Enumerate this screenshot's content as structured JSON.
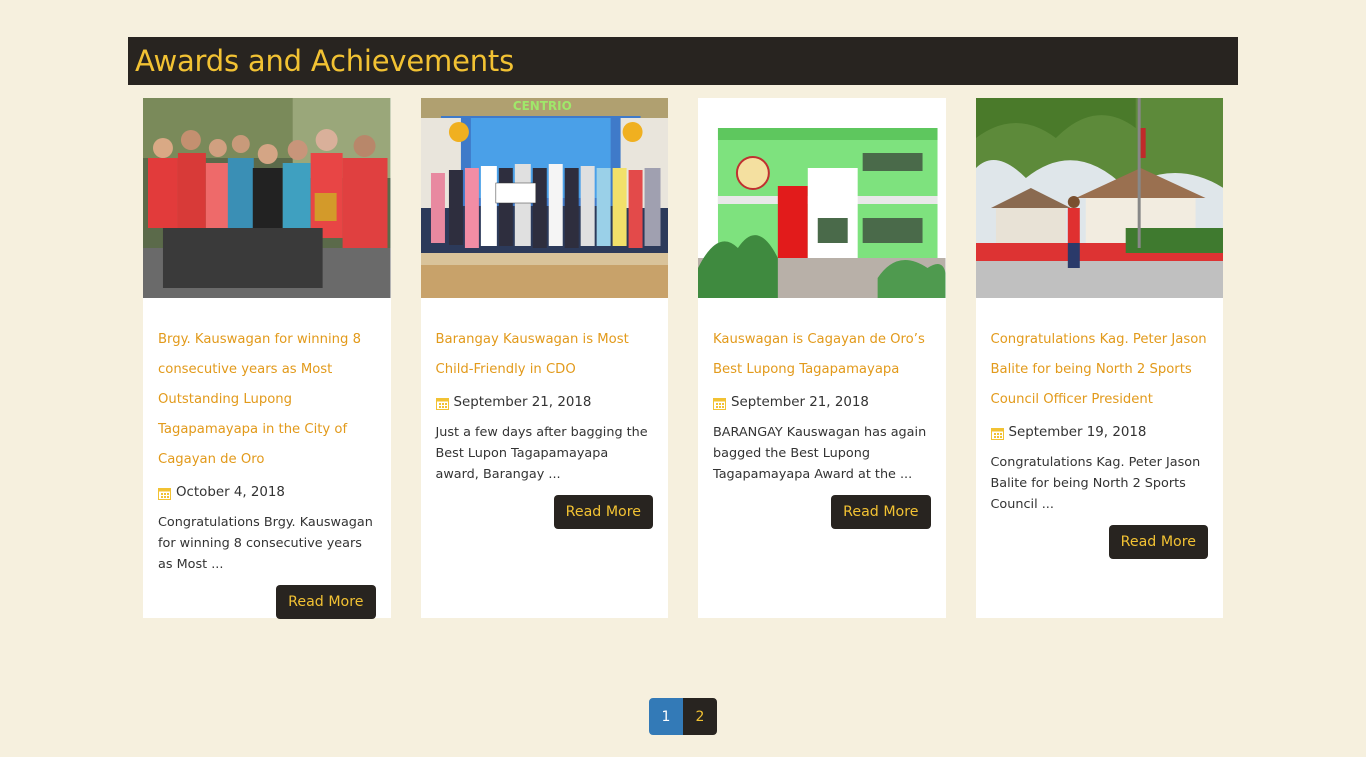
{
  "header": {
    "title": "Awards and Achievements"
  },
  "icons": {
    "date": "calendar-icon"
  },
  "colors": {
    "accent": "#f2c233",
    "link": "#e29a1b",
    "dark": "#282420",
    "page_bg": "#f6f0de",
    "active_page": "#337ab7"
  },
  "cards": [
    {
      "title": "Brgy. Kauswagan for winning 8 consecutive years as Most Outstanding Lupong Tagapamayapa in the City of Cagayan de Oro",
      "date": "October 4, 2018",
      "excerpt": "Congratulations Brgy. Kauswagan for winning 8 consecutive years as Most ...",
      "button": "Read More"
    },
    {
      "title": "Barangay Kauswagan is Most Child-Friendly in CDO",
      "date": "September 21, 2018",
      "excerpt": "Just a few days after bagging the Best Lupon Tagapamayapa award, Barangay ...",
      "button": "Read More"
    },
    {
      "title": "Kauswagan is Cagayan de Oro’s Best Lupong Tagapamayapa",
      "date": "September 21, 2018",
      "excerpt": "BARANGAY Kauswagan has again bagged the Best Lupong Tagapamayapa Award at the ...",
      "button": "Read More"
    },
    {
      "title": "Congratulations Kag. Peter Jason Balite for being North 2 Sports Council Officer President",
      "date": "September 19, 2018",
      "excerpt": "Congratulations Kag. Peter Jason Balite for being North 2 Sports Council ...",
      "button": "Read More"
    }
  ],
  "pagination": {
    "current": "1",
    "next": "2"
  }
}
